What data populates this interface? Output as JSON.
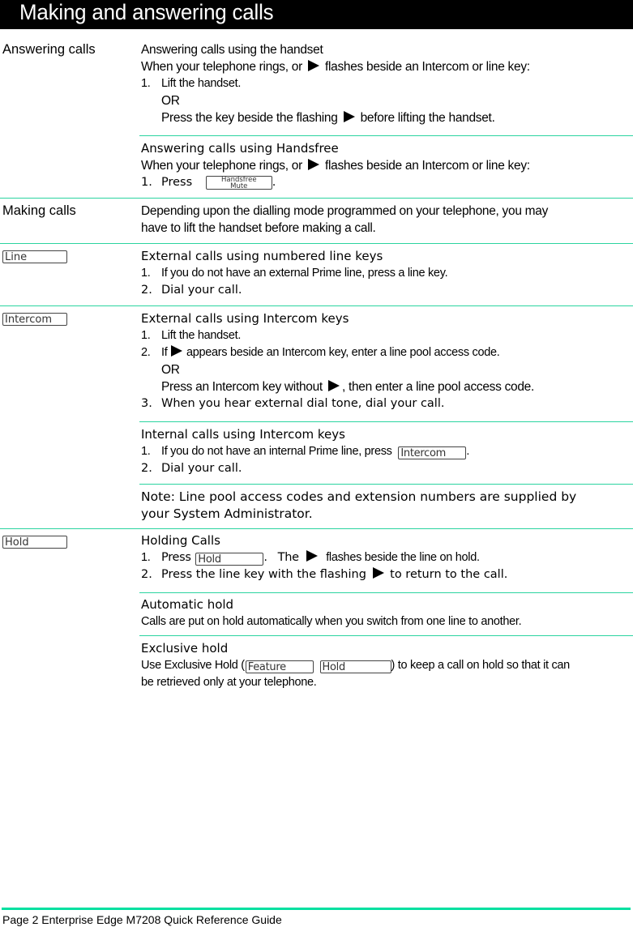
{
  "title": "Making and answering calls",
  "answering": {
    "label": "Answering calls",
    "handset": {
      "heading": "Answering calls using the handset",
      "intro_before": "When your telephone rings, or",
      "intro_after": "flashes beside an Intercom or line key:",
      "step1_num": "1.",
      "step1": "Lift the handset.",
      "or": "OR",
      "alt_before": "Press the key beside the flashing",
      "alt_after": "before lifting the handset."
    },
    "handsfree": {
      "heading": "Answering calls using Handsfree",
      "intro_before": "When your telephone rings, or",
      "intro_after": "flashes beside an Intercom or line key:",
      "step1_num": "1.",
      "step1": "Press",
      "key_top": "Handsfree",
      "key_bottom": "Mute",
      "step1_end": "."
    }
  },
  "making": {
    "label": "Making calls",
    "text1": "Depending upon the dialling mode programmed on your telephone, you may",
    "text2": "have to lift the handset before making a call."
  },
  "external_line": {
    "key_label": "Line",
    "heading": "External calls using numbered line keys",
    "steps": [
      {
        "num": "1.",
        "text": "If you do not have an external Prime line, press a line key."
      },
      {
        "num": "2.",
        "text": "Dial your call."
      }
    ]
  },
  "external_intercom": {
    "key_label": "Intercom",
    "heading": "External calls using Intercom keys",
    "step1_num": "1.",
    "step1": "Lift the handset.",
    "step2_num": "2.",
    "step2_before": "If",
    "step2_after": "appears beside an Intercom key, enter a line pool access code.",
    "or": "OR",
    "alt_before": "Press an Intercom key without",
    "alt_after": ", then enter a line pool access code.",
    "step3_num": "3.",
    "step3": "When you hear external dial tone, dial your call."
  },
  "internal_intercom": {
    "heading": "Internal calls using Intercom keys",
    "step1_num": "1.",
    "step1": "If you do not have an internal Prime line, press",
    "step1_key": "Intercom",
    "step1_end": ".",
    "step2_num": "2.",
    "step2": "Dial your call."
  },
  "note": {
    "line1": "Note: Line pool access codes and extension numbers are supplied by",
    "line2": "your System Administrator."
  },
  "holding": {
    "key_label": "Hold",
    "heading": "Holding Calls",
    "step1_num": "1.",
    "step1_press": "Press",
    "step1_key": "Hold",
    "step1_mid": ".   The",
    "step1_after": "flashes beside the line on hold.",
    "step2_num": "2.",
    "step2_before": "Press the line key with the flashing",
    "step2_after": "to return to the call."
  },
  "automatic_hold": {
    "heading": "Automatic hold",
    "text": "Calls are put on hold automatically when you switch from one line to another."
  },
  "exclusive_hold": {
    "heading": "Exclusive hold",
    "text_before": "Use Exclusive Hold (",
    "key1": "Feature",
    "key2": "Hold",
    "text_after": ") to keep a call on hold so that it can",
    "line2": "be retrieved only at your telephone."
  },
  "footer": "Page 2 Enterprise Edge M7208 Quick Reference Guide",
  "colors": {
    "divider": "#2bd4a0",
    "footer_bar": "#00e0a0",
    "title_bg": "#000000",
    "title_text": "#ffffff"
  }
}
